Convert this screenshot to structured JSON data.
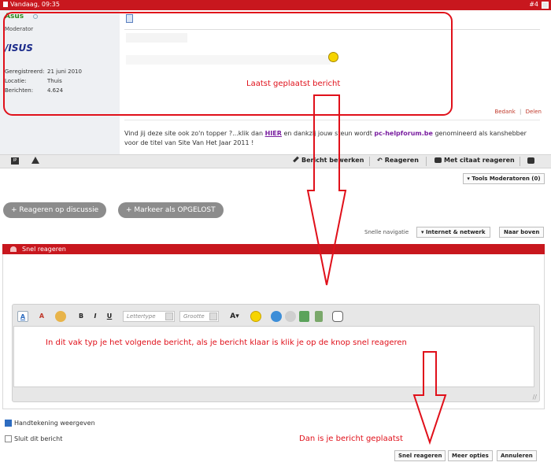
{
  "post": {
    "date": "Vandaag, 09:35",
    "number": "#4",
    "user": {
      "name": "Asus",
      "title": "Moderator",
      "logo_text": "/ISUS",
      "registered_label": "Geregistreerd:",
      "registered_value": "21 juni 2010",
      "location_label": "Locatie:",
      "location_value": "Thuis",
      "posts_label": "Berichten:",
      "posts_value": "4.624"
    },
    "actions": {
      "thanks": "Bedank",
      "separator": "|",
      "share": "Delen"
    },
    "signature": {
      "part1": "Vind jij deze site ook zo'n topper ?...klik dan ",
      "link": "HIER",
      "part2": " en dankzij jouw steun wordt ",
      "brand": "pc-helpforum.be",
      "part3": " genomineerd als kanshebber voor de titel van Site Van Het Jaar 2011 !"
    }
  },
  "toolbar": {
    "edit": "Bericht bewerken",
    "reply": "Reageren",
    "quote": "Met citaat reageren",
    "tools": "▾ Tools Moderatoren (0)"
  },
  "thread_buttons": {
    "reply_thread": "+ Reageren op discussie",
    "mark_solved": "+ Markeer als OPGELOST"
  },
  "quicknav": {
    "label": "Snelle navigatie",
    "forum": "▾ Internet & netwerk",
    "top": "Naar boven"
  },
  "quick_reply": {
    "header": "Snel reageren",
    "font_placeholder": "Lettertype",
    "size_placeholder": "Grootte",
    "show_signature": "Handtekening weergeven",
    "close_thread": "Sluit dit bericht",
    "submit": "Snel reageren",
    "more": "Meer opties",
    "cancel": "Annuleren"
  },
  "annotations": {
    "last_posted": "Laatst geplaatst bericht",
    "instructions": "In dit vak typ je het volgende bericht, als je bericht klaar is klik je op de knop snel reageren",
    "done": "Dan is je bericht geplaatst"
  },
  "colors": {
    "header_red": "#c8171e",
    "annotation_red": "#e0101a",
    "user_green": "#2a8a1a",
    "brand_purple": "#7a1fa0"
  }
}
